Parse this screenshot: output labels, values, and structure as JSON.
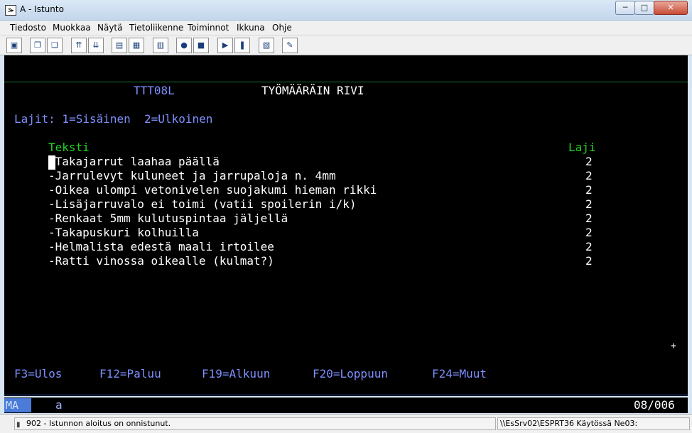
{
  "window": {
    "title": "A - Istunto",
    "icon": "terminal-session-icon"
  },
  "menu": [
    "Tiedosto",
    "Muokkaa",
    "Näytä",
    "Tietoliikenne",
    "Toiminnot",
    "Ikkuna",
    "Ohje"
  ],
  "toolbar": [
    {
      "name": "print-screen-icon",
      "glyph": "▣"
    },
    {
      "name": "copy-icon",
      "glyph": "❐"
    },
    {
      "name": "paste-icon",
      "glyph": "❏"
    },
    {
      "name": "send-file-icon",
      "glyph": "⇈"
    },
    {
      "name": "receive-file-icon",
      "glyph": "⇊"
    },
    {
      "name": "display-icon",
      "glyph": "▤"
    },
    {
      "name": "keyboard-map-icon",
      "glyph": "▦"
    },
    {
      "name": "macro-icon",
      "glyph": "▥"
    },
    {
      "name": "record-macro-icon",
      "glyph": "●"
    },
    {
      "name": "stop-macro-icon",
      "glyph": "■"
    },
    {
      "name": "play-macro-icon",
      "glyph": "▶"
    },
    {
      "name": "pause-macro-icon",
      "glyph": "❚"
    },
    {
      "name": "clipboard-icon",
      "glyph": "▧"
    },
    {
      "name": "help-icon",
      "glyph": "✎"
    }
  ],
  "screen": {
    "program": "TTT08L",
    "heading": "TYÖMÄÄRÄIN RIVI",
    "types_line": "Lajit: 1=Sisäinen  2=Ulkoinen",
    "col_text": "Teksti",
    "col_type": "Laji",
    "rows": [
      {
        "text": "-Takajarrut laahaa päällä",
        "type": "2"
      },
      {
        "text": "-Jarrulevyt kuluneet ja jarrupaloja n. 4mm",
        "type": "2"
      },
      {
        "text": "-Oikea ulompi vetonivelen suojakumi hieman rikki",
        "type": "2"
      },
      {
        "text": "-Lisäjarruvalo ei toimi (vatii spoilerin i/k)",
        "type": "2"
      },
      {
        "text": "-Renkaat 5mm kulutuspintaa jäljellä",
        "type": "2"
      },
      {
        "text": "-Takapuskuri kolhuilla",
        "type": "2"
      },
      {
        "text": "-Helmalista edestä maali irtoilee",
        "type": "2"
      },
      {
        "text": "-Ratti vinossa oikealle (kulmat?)",
        "type": "2"
      }
    ],
    "more": "+",
    "fkeys": [
      "F3=Ulos",
      "F12=Paluu",
      "F19=Alkuun",
      "F20=Loppuun",
      "F24=Muut"
    ]
  },
  "oia": {
    "mode": "MA",
    "indicator": "a",
    "cursor_pos": "08/006"
  },
  "status": {
    "message": "902 - Istunnon aloitus on onnistunut.",
    "connection": "\\\\EsSrv02\\ESPRT36 Käytössä Ne03:"
  }
}
